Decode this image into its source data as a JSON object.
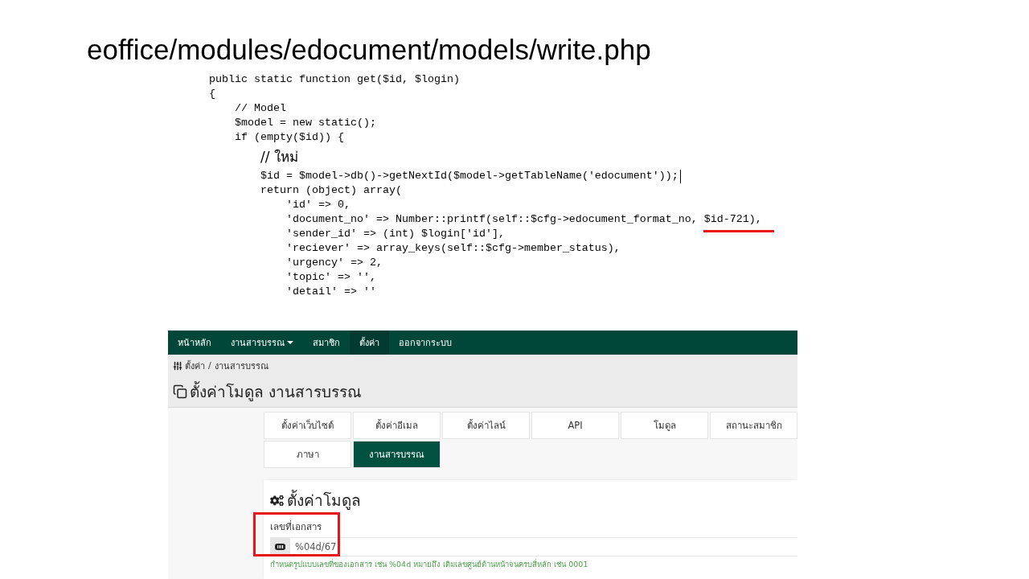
{
  "title": "eoffice/modules/edocument/models/write.php",
  "code": {
    "lines": [
      {
        "kind": "code",
        "text": "public static function get($id, $login)",
        "caret": false
      },
      {
        "kind": "code",
        "text": "{",
        "caret": false,
        "children": [
          {
            "kind": "code",
            "text": "// Model",
            "caret": false
          },
          {
            "kind": "code",
            "text": "$model = new static();",
            "caret": false
          },
          {
            "kind": "code",
            "text": "if (empty($id)) {",
            "caret": false,
            "children": [
              {
                "kind": "note",
                "text": "// ใหม่",
                "caret": false
              },
              {
                "kind": "code",
                "text": "$id = $model->db()->getNextId($model->getTableName('edocument'));",
                "caret": true
              },
              {
                "kind": "code",
                "text": "return (object) array(",
                "caret": false,
                "children": [
                  {
                    "kind": "code",
                    "text": "'id' => 0,",
                    "caret": false
                  },
                  {
                    "kind": "code",
                    "text": "'document_no' => Number::printf(self::$cfg->edocument_format_no, ",
                    "underlined": "$id-721),",
                    "caret": false
                  },
                  {
                    "kind": "code",
                    "text": "'sender_id' => (int) $login['id'],",
                    "caret": false
                  },
                  {
                    "kind": "code",
                    "text": "'reciever' => array_keys(self::$cfg->member_status),",
                    "caret": false
                  },
                  {
                    "kind": "code",
                    "text": "'urgency' => 2,",
                    "caret": false
                  },
                  {
                    "kind": "code",
                    "text": "'topic' => '',",
                    "caret": false
                  },
                  {
                    "kind": "code",
                    "text": "'detail' => ''",
                    "caret": false
                  }
                ]
              }
            ]
          }
        ]
      }
    ]
  },
  "app": {
    "navbar": [
      {
        "label": "หน้าหลัก",
        "selected": false,
        "dropdown": false
      },
      {
        "label": "งานสารบรรณ",
        "selected": false,
        "dropdown": true
      },
      {
        "label": "สมาชิก",
        "selected": false,
        "dropdown": false
      },
      {
        "label": "ตั้งค่า",
        "selected": true,
        "dropdown": false
      },
      {
        "label": "ออกจากระบบ",
        "selected": false,
        "dropdown": false
      }
    ],
    "breadcrumb": {
      "items": [
        "ตั้งค่า",
        "งานสารบรรณ"
      ],
      "separator": "/"
    },
    "page_title": "ตั้งค่าโมดูล งานสารบรรณ",
    "tabs": [
      {
        "label": "ตั้งค่าเว็บไซต์",
        "selected": false
      },
      {
        "label": "ตั้งค่าอีเมล",
        "selected": false
      },
      {
        "label": "ตั้งค่าไลน์",
        "selected": false
      },
      {
        "label": "API",
        "selected": false
      },
      {
        "label": "โมดูล",
        "selected": false
      },
      {
        "label": "สถานะสมาชิก",
        "selected": false
      },
      {
        "label": "ภาษา",
        "selected": false
      },
      {
        "label": "งานสารบรรณ",
        "selected": true
      }
    ],
    "panel": {
      "title": "ตั้งค่าโมดูล",
      "fields": [
        {
          "label": "เลขที่เอกสาร",
          "value": "%04d/67",
          "hint": "กำหนดรูปแบบเลขที่ของเอกสาร เช่น %04d หมายถึง เติมเลขศูนย์ด้านหน้าจนครบสี่หลัก เช่น 0001",
          "highlighted": true
        }
      ]
    }
  }
}
